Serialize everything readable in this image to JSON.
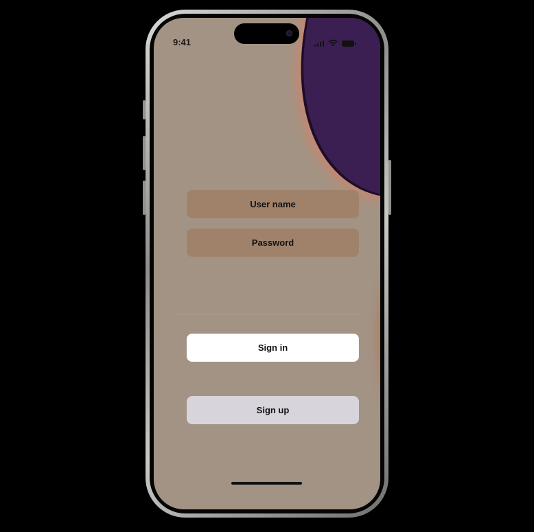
{
  "status_bar": {
    "time": "9:41",
    "signal_icon": "cellular-signal-icon",
    "wifi_icon": "wifi-icon",
    "battery_icon": "battery-icon"
  },
  "login_form": {
    "username_placeholder": "User name",
    "password_placeholder": "Password"
  },
  "actions": {
    "sign_in_label": "Sign in",
    "sign_up_label": "Sign up"
  },
  "colors": {
    "screen_background": "#a39384",
    "input_fill": "#a0826b",
    "sign_in_fill": "#ffffff",
    "sign_up_fill": "#d8d4dc",
    "accent_purple": "#3b1e52"
  }
}
